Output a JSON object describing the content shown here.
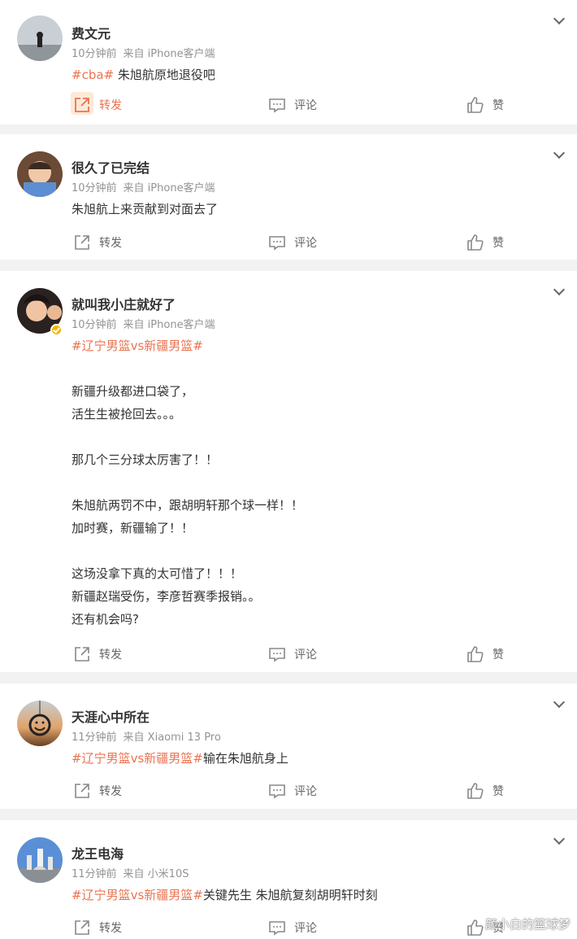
{
  "posts": [
    {
      "name": "费文元",
      "time": "10分钟前",
      "source": "来自 iPhone客户端",
      "tag": "#cba#",
      "text": " 朱旭航原地退役吧",
      "repost_label": "转发",
      "comment_label": "评论",
      "like_label": "赞",
      "verified": false
    },
    {
      "name": "很久了已完结",
      "time": "10分钟前",
      "source": "来自 iPhone客户端",
      "tag": "",
      "text": "朱旭航上来贡献到对面去了",
      "repost_label": "转发",
      "comment_label": "评论",
      "like_label": "赞",
      "verified": false
    },
    {
      "name": "就叫我小庄就好了",
      "time": "10分钟前",
      "source": "来自 iPhone客户端",
      "tag": "#辽宁男篮vs新疆男篮#",
      "text": "\n\n新疆升级都进口袋了，\n活生生被抢回去。。。\n\n那几个三分球太厉害了！！\n\n朱旭航两罚不中，跟胡明轩那个球一样！！\n加时赛，新疆输了！！\n\n这场没拿下真的太可惜了！！！\n新疆赵瑞受伤，李彦哲赛季报销。。\n还有机会吗?",
      "repost_label": "转发",
      "comment_label": "评论",
      "like_label": "赞",
      "verified": true
    },
    {
      "name": "天涯心中所在",
      "time": "11分钟前",
      "source": "来自 Xiaomi 13 Pro",
      "tag": "#辽宁男篮vs新疆男篮#",
      "text": "输在朱旭航身上",
      "repost_label": "转发",
      "comment_label": "评论",
      "like_label": "赞",
      "verified": false
    },
    {
      "name": "龙王电海",
      "time": "11分钟前",
      "source": "来自 小米10S",
      "tag": "#辽宁男篮vs新疆男篮#",
      "text": "关键先生 朱旭航复刻胡明轩时刻",
      "repost_label": "转发",
      "comment_label": "评论",
      "like_label": "赞",
      "verified": false
    }
  ],
  "watermark": "颜小白的篮球梦",
  "colors": {
    "tag": "#eb7350",
    "meta": "#939393",
    "separator": "#f2f2f2",
    "verified": "#f7b500"
  }
}
